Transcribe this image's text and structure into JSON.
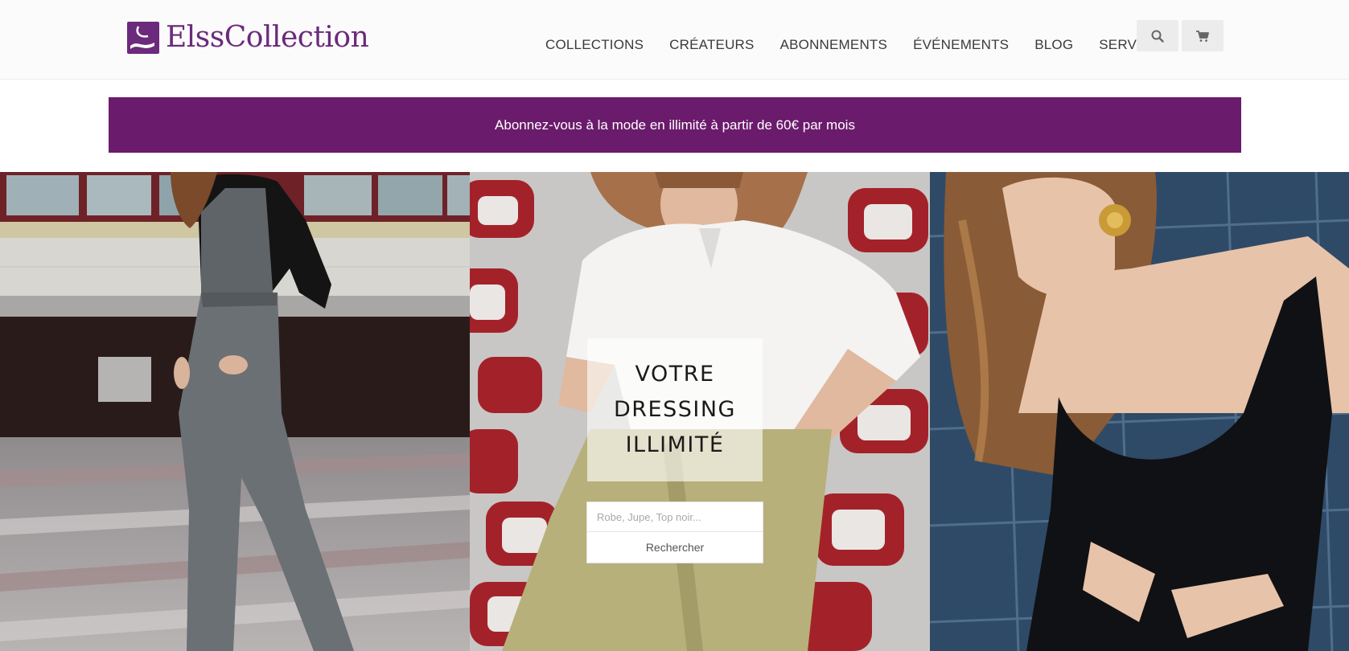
{
  "brand": {
    "name": "ElssCollection",
    "color": "#6b2a7b"
  },
  "nav": {
    "items": [
      {
        "label": "COLLECTIONS"
      },
      {
        "label": "CRÉATEURS"
      },
      {
        "label": "ABONNEMENTS"
      },
      {
        "label": "ÉVÉNEMENTS"
      },
      {
        "label": "BLOG"
      },
      {
        "label": "SERVICES"
      }
    ]
  },
  "header_icons": {
    "search": "search-icon",
    "cart": "cart-icon"
  },
  "promo": {
    "text": "Abonnez-vous à la mode en illimité à partir de 60€ par mois",
    "color": "#6b1b6b"
  },
  "hero": {
    "line1": "VOTRE",
    "line2": "DRESSING",
    "line3": "ILLIMITÉ"
  },
  "search": {
    "placeholder": "Robe, Jupe, Top noir...",
    "button_label": "Rechercher"
  }
}
